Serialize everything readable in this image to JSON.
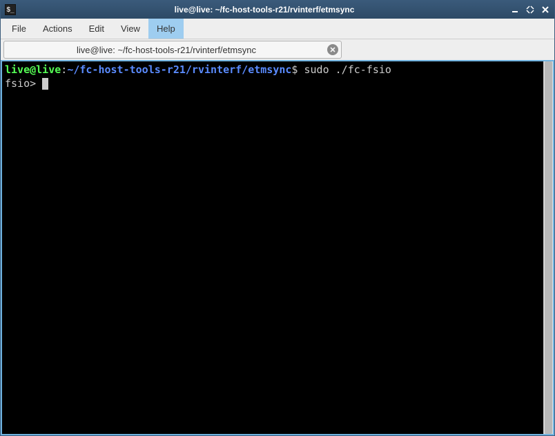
{
  "titlebar": {
    "icon_glyph": "$_",
    "title": "live@live: ~/fc-host-tools-r21/rvinterf/etmsync"
  },
  "menubar": {
    "items": [
      {
        "label": "File",
        "highlighted": false
      },
      {
        "label": "Actions",
        "highlighted": false
      },
      {
        "label": "Edit",
        "highlighted": false
      },
      {
        "label": "View",
        "highlighted": false
      },
      {
        "label": "Help",
        "highlighted": true
      }
    ]
  },
  "tabs": [
    {
      "label": "live@live: ~/fc-host-tools-r21/rvinterf/etmsync"
    }
  ],
  "terminal": {
    "prompt_user": "live@live",
    "prompt_sep": ":",
    "prompt_path": "~/fc-host-tools-r21/rvinterf/etmsync",
    "prompt_end": "$ ",
    "command": "sudo ./fc-fsio",
    "line2": "fsio> "
  }
}
